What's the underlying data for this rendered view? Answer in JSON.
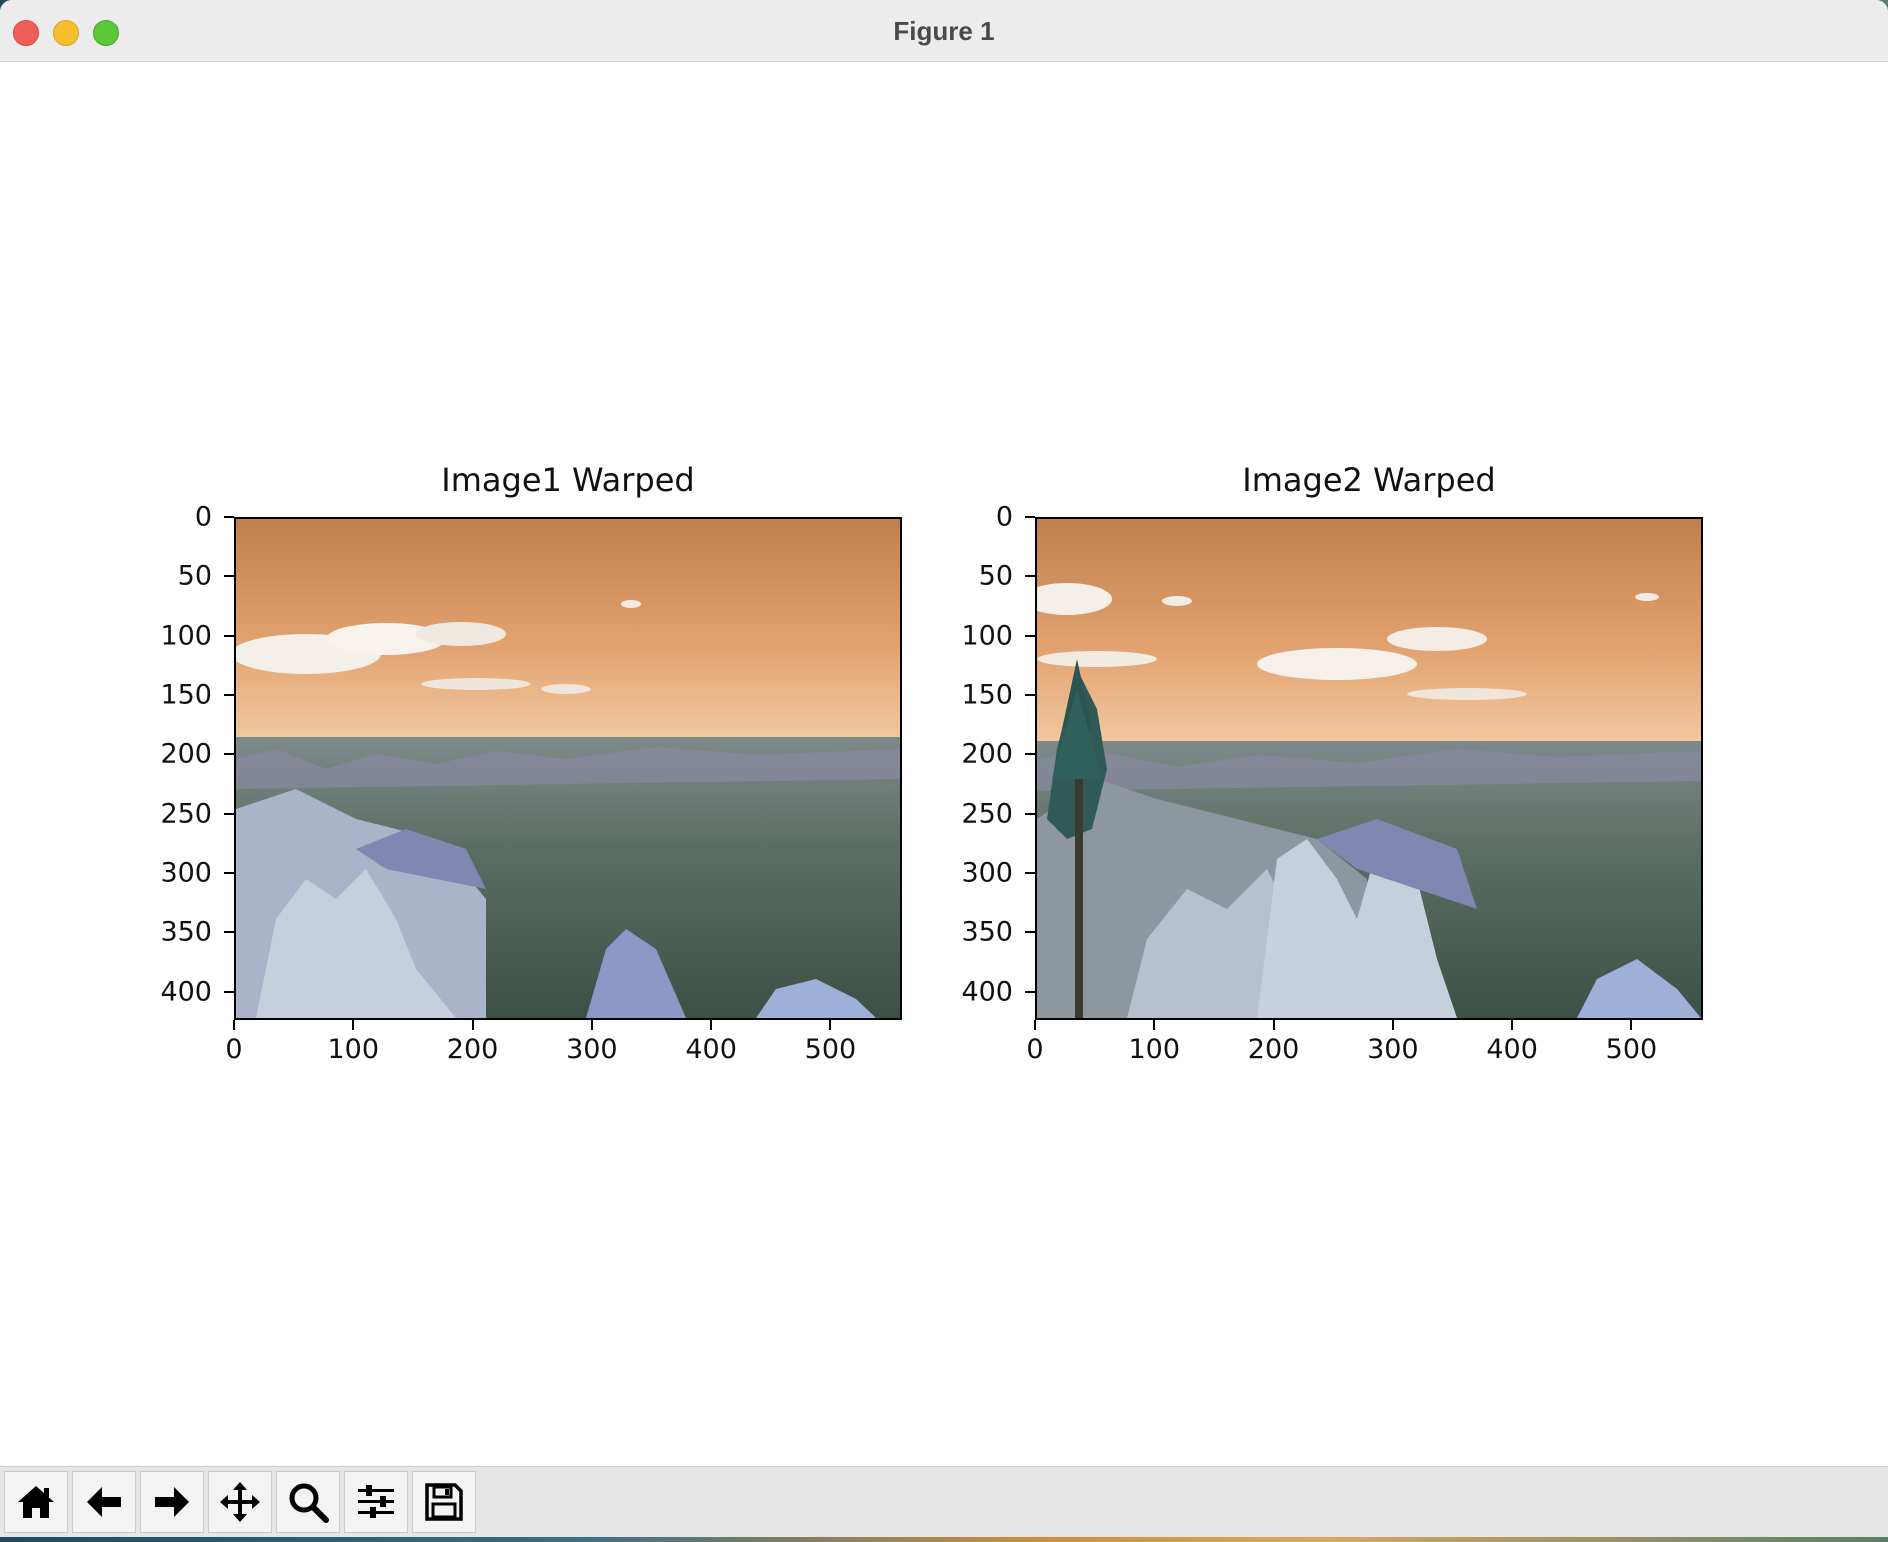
{
  "window": {
    "title": "Figure 1"
  },
  "axes": [
    {
      "title": "Image1 Warped",
      "yticks": [
        "0",
        "50",
        "100",
        "150",
        "200",
        "250",
        "300",
        "350",
        "400"
      ],
      "xticks": [
        "0",
        "100",
        "200",
        "300",
        "400",
        "500"
      ]
    },
    {
      "title": "Image2 Warped",
      "yticks": [
        "0",
        "50",
        "100",
        "150",
        "200",
        "250",
        "300",
        "350",
        "400"
      ],
      "xticks": [
        "0",
        "100",
        "200",
        "300",
        "400",
        "500"
      ]
    }
  ],
  "toolbar": {
    "buttons": [
      "home-icon",
      "back-arrow-icon",
      "forward-arrow-icon",
      "pan-move-icon",
      "zoom-magnifier-icon",
      "configure-subplots-icon",
      "save-floppy-icon"
    ]
  }
}
